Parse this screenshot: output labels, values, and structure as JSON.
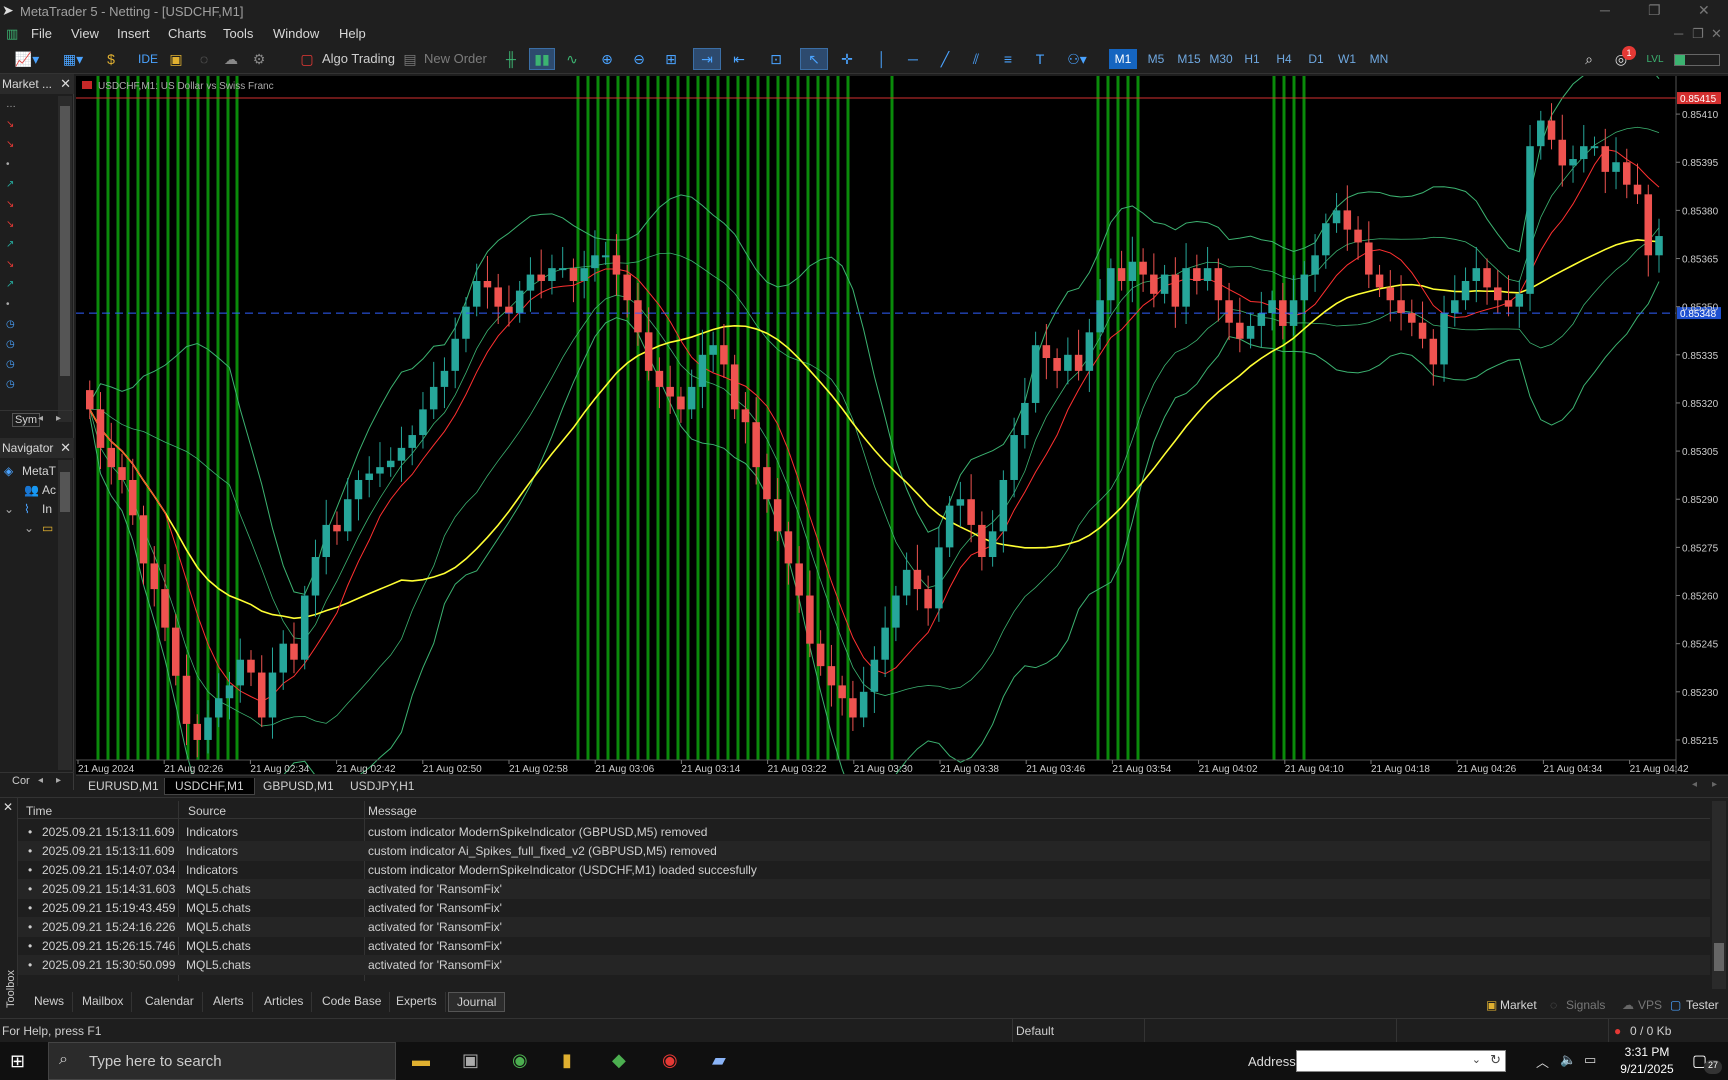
{
  "window": {
    "title": "MetaTrader 5 - Netting - [USDCHF,M1]"
  },
  "menu": [
    "File",
    "View",
    "Insert",
    "Charts",
    "Tools",
    "Window",
    "Help"
  ],
  "toolbar": {
    "algo_trading": "Algo Trading",
    "new_order": "New Order",
    "ide": "IDE",
    "timeframes": [
      "M1",
      "M5",
      "M15",
      "M30",
      "H1",
      "H4",
      "D1",
      "W1",
      "MN"
    ],
    "selected_timeframe": "M1",
    "notification_count": "1"
  },
  "market_watch": {
    "title": "Market ...",
    "tab_label": "Sym"
  },
  "navigator": {
    "title": "Navigator",
    "items": [
      "MetaT",
      "Ac",
      "In"
    ]
  },
  "chart": {
    "label": "USDCHF,M1:  US Dollar vs Swiss Franc",
    "price_labels": [
      "0.85410",
      "0.85395",
      "0.85380",
      "0.85365",
      "0.85350",
      "0.85335",
      "0.85320",
      "0.85305",
      "0.85290",
      "0.85275",
      "0.85260",
      "0.85245",
      "0.85230",
      "0.85215"
    ],
    "price_min": 0.8521,
    "price_max": 0.8542,
    "red_line_price": "0.85415",
    "blue_line_price": "0.85348",
    "time_labels": [
      "21 Aug 2024",
      "21 Aug 02:26",
      "21 Aug 02:34",
      "21 Aug 02:42",
      "21 Aug 02:50",
      "21 Aug 02:58",
      "21 Aug 03:06",
      "21 Aug 03:14",
      "21 Aug 03:22",
      "21 Aug 03:30",
      "21 Aug 03:38",
      "21 Aug 03:46",
      "21 Aug 03:54",
      "21 Aug 04:02",
      "21 Aug 04:10",
      "21 Aug 04:18",
      "21 Aug 04:26",
      "21 Aug 04:34",
      "21 Aug 04:42"
    ]
  },
  "chart_tabs": [
    "EURUSD,M1",
    "USDCHF,M1",
    "GBPUSD,M1",
    "USDJPY,H1"
  ],
  "selected_chart_tab": "USDCHF,M1",
  "journal": {
    "headers": [
      "Time",
      "Source",
      "Message"
    ],
    "rows": [
      {
        "time": "2025.09.21 15:13:11.609",
        "source": "Indicators",
        "message": "custom indicator ModernSpikeIndicator (GBPUSD,M5) removed"
      },
      {
        "time": "2025.09.21 15:13:11.609",
        "source": "Indicators",
        "message": "custom indicator Ai_Spikes_full_fixed_v2 (GBPUSD,M5) removed"
      },
      {
        "time": "2025.09.21 15:14:07.034",
        "source": "Indicators",
        "message": "custom indicator ModernSpikeIndicator (USDCHF,M1) loaded succesfully"
      },
      {
        "time": "2025.09.21 15:14:31.603",
        "source": "MQL5.chats",
        "message": "activated for 'RansomFix'"
      },
      {
        "time": "2025.09.21 15:19:43.459",
        "source": "MQL5.chats",
        "message": "activated for 'RansomFix'"
      },
      {
        "time": "2025.09.21 15:24:16.226",
        "source": "MQL5.chats",
        "message": "activated for 'RansomFix'"
      },
      {
        "time": "2025.09.21 15:26:15.746",
        "source": "MQL5.chats",
        "message": "activated for 'RansomFix'"
      },
      {
        "time": "2025.09.21 15:30:50.099",
        "source": "MQL5.chats",
        "message": "activated for 'RansomFix'"
      }
    ]
  },
  "toolbox_tabs": [
    "News",
    "Mailbox",
    "Calendar",
    "Alerts",
    "Articles",
    "Code Base",
    "Experts",
    "Journal"
  ],
  "selected_toolbox_tab": "Journal",
  "toolbox_label": "Toolbox",
  "toolbox_right": [
    "Market",
    "Signals",
    "VPS",
    "Tester"
  ],
  "status": {
    "help": "For Help, press F1",
    "profile": "Default",
    "traffic": "0 / 0 Kb"
  },
  "taskbar": {
    "search_placeholder": "Type here to search",
    "address_label": "Address",
    "time": "3:31 PM",
    "date": "9/21/2025",
    "notif_count": "27"
  },
  "colors": {
    "bull": "#26a69a",
    "bear": "#ef5350",
    "ma_yellow": "#ffff33",
    "ma_red": "#ff3030",
    "bands": "#3cb371",
    "spike_line": "#0a8a0a",
    "bid_line": "#3060ff"
  }
}
